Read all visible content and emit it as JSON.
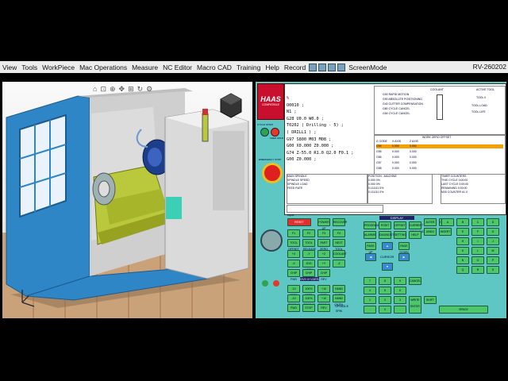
{
  "menu": {
    "items": [
      "View",
      "Tools",
      "WorkPiece",
      "Mac Operations",
      "Measure",
      "NC Editor",
      "Macro CAD",
      "Training",
      "Help",
      "Record"
    ],
    "screen_mode": "ScreenMode",
    "version": "RV-260202"
  },
  "brand": {
    "logo": "HAAS",
    "sub": "COMPATIBLE"
  },
  "program": {
    "lines": [
      "%",
      "O0010 ;",
      "N1 ;",
      "G28 U0.0 W0.0 ;",
      "T0202 ( Drilling - 5) ;",
      "( DRILL1 ) ;",
      "G97 S800 M03 M08 ;",
      "G00 X0.000 Z0.000 ;",
      "G74 Z-55.0 R1.0 Q2.0 F0.1 ;",
      "G00 Z0.000 ;"
    ]
  },
  "active_codes": {
    "rows": [
      "G00 RAPID MOTION",
      "G90 ABSOLUTE POSITIONING",
      "G40 CUTTER COMPENSATION",
      "G80 CYCLE CANCEL",
      "G54 CYCLE CANCEL"
    ],
    "active_tool_label": "ACTIVE TOOL",
    "tool": "TOOL 0",
    "coolant_label": "COOLANT",
    "tool_load": "TOOL LOAD",
    "tool_life": "TOOL LIFE"
  },
  "work_offsets": {
    "title": "WORK ZERO OFFSET",
    "headers": [
      "G CODE",
      "X AXIS",
      "Z AXIS"
    ],
    "rows": [
      [
        "G54",
        "0.000",
        "0.000"
      ],
      [
        "G55",
        "0.000",
        "0.000"
      ],
      [
        "G56",
        "0.000",
        "0.000"
      ],
      [
        "G57",
        "0.000",
        "0.000"
      ],
      [
        "G58",
        "0.000",
        "0.000"
      ]
    ]
  },
  "main_spindle": {
    "title": "MAIN SPINDLE",
    "labels": [
      "SPINDLE SPEED",
      "SPINDLE LOAD",
      "SURFACE SPEED",
      "CHIP LOAD",
      "FEED RATE",
      "ACT. FEED",
      "G.FEED",
      "TURRET"
    ],
    "values": [
      "0",
      "0",
      "0",
      "0",
      "0",
      "0",
      "0",
      "0"
    ]
  },
  "position": {
    "title": "POSITION : MACHINE",
    "headers": [
      "AXIS",
      "LOAD"
    ],
    "rows": [
      [
        "X",
        "0.000",
        "0%"
      ],
      [
        "Y",
        "0.000",
        "0%"
      ],
      [
        "Z",
        "0.111111",
        "0%"
      ],
      [
        "W",
        "0.111111",
        "0%"
      ]
    ]
  },
  "timers": {
    "title": "TIMER COUNTERS",
    "rows": [
      [
        "THIS CYCLE",
        "0:00:00"
      ],
      [
        "LAST CYCLE",
        "0:00:00"
      ],
      [
        "REMAINING",
        "0:00:00"
      ],
      [
        "M30 COUNTER #1",
        "0"
      ],
      [
        "M30 COUNTER #2",
        "0"
      ],
      [
        "LOOPS REMAINING",
        "0"
      ]
    ]
  },
  "input_label": "Input:",
  "groups": {
    "display": "DISPLAY",
    "cursor": "CURSOR",
    "overrides": "OVERRIDES",
    "spindle": "SPINDLE"
  },
  "keys": {
    "cycle_start": "CYCLE START",
    "feed_hold": "FEED HOLD",
    "emergency_stop": "EMERGENCY STOP",
    "power_on": "POWER ON",
    "power_off": "POWER OFF",
    "function": [
      "RESET",
      "POWER UP",
      "RECOVER",
      "F1",
      "F2",
      "F3",
      "F4",
      "TOOL OFFSET",
      "TOOL RELEASE",
      "PART ZERO SET",
      "NEXT TOOL",
      "HAND CONT",
      "SELECT"
    ],
    "display": [
      "PROGRAM",
      "POSIT",
      "OFFSET",
      "CURRENT COMMANDS",
      "ALARMS",
      "DIAGNOSTIC",
      "SETTING",
      "HELP"
    ],
    "cursor": [
      "PAGE UP",
      "HOME",
      "UP",
      "PAGE DOWN",
      "END",
      "LEFT",
      "CURSOR",
      "RIGHT",
      "DOWN"
    ],
    "editing": [
      "ALTER",
      "DELETE",
      "UNDO",
      "INSERT",
      "F5",
      "F6",
      "INSERT",
      "RESTRT"
    ],
    "jog": [
      "+X",
      "-Y",
      "+Z",
      "-X",
      "+Y",
      "-Z",
      "JOG LOCK",
      "COOLANT",
      "CHIP FWD",
      "CHIP STOP",
      "CHIP REV"
    ],
    "overrides": [
      "-10 FEED RATE",
      "100% FEED RATE",
      "+10 FEED RATE",
      "HAND CNTRL FEED",
      "-10 SPINDLE",
      "100% SPINDLE",
      "+10 SPINDLE",
      "HAND CNTRL SPIN",
      "FWD",
      "STOP",
      "REV",
      "5% RAPID",
      "25% RAPID",
      "50% RAPID",
      "100% RAPID"
    ],
    "alpha": [
      "A",
      "B",
      "C",
      "D",
      "E",
      "F",
      "G",
      "H",
      "I",
      "J",
      "K",
      "L",
      "M",
      "N",
      "O",
      "P",
      "Q",
      "R",
      "S",
      "T",
      "U",
      "V",
      "W",
      "X",
      "Y",
      "Z",
      "EOB",
      "(",
      ")",
      "/",
      "SHIFT",
      "SPACE"
    ],
    "numeric": [
      "7",
      "8",
      "9",
      "4",
      "5",
      "6",
      "1",
      "2",
      "3",
      "-",
      "0",
      ".",
      "CANCEL",
      "WRITE ENTER"
    ]
  },
  "colors": {
    "panel": "#5fc7c3",
    "key": "#4ec66a",
    "machine_blue": "#2f86c7",
    "machine_grey": "#cfcfcf",
    "chuck": "#b9c93b"
  }
}
